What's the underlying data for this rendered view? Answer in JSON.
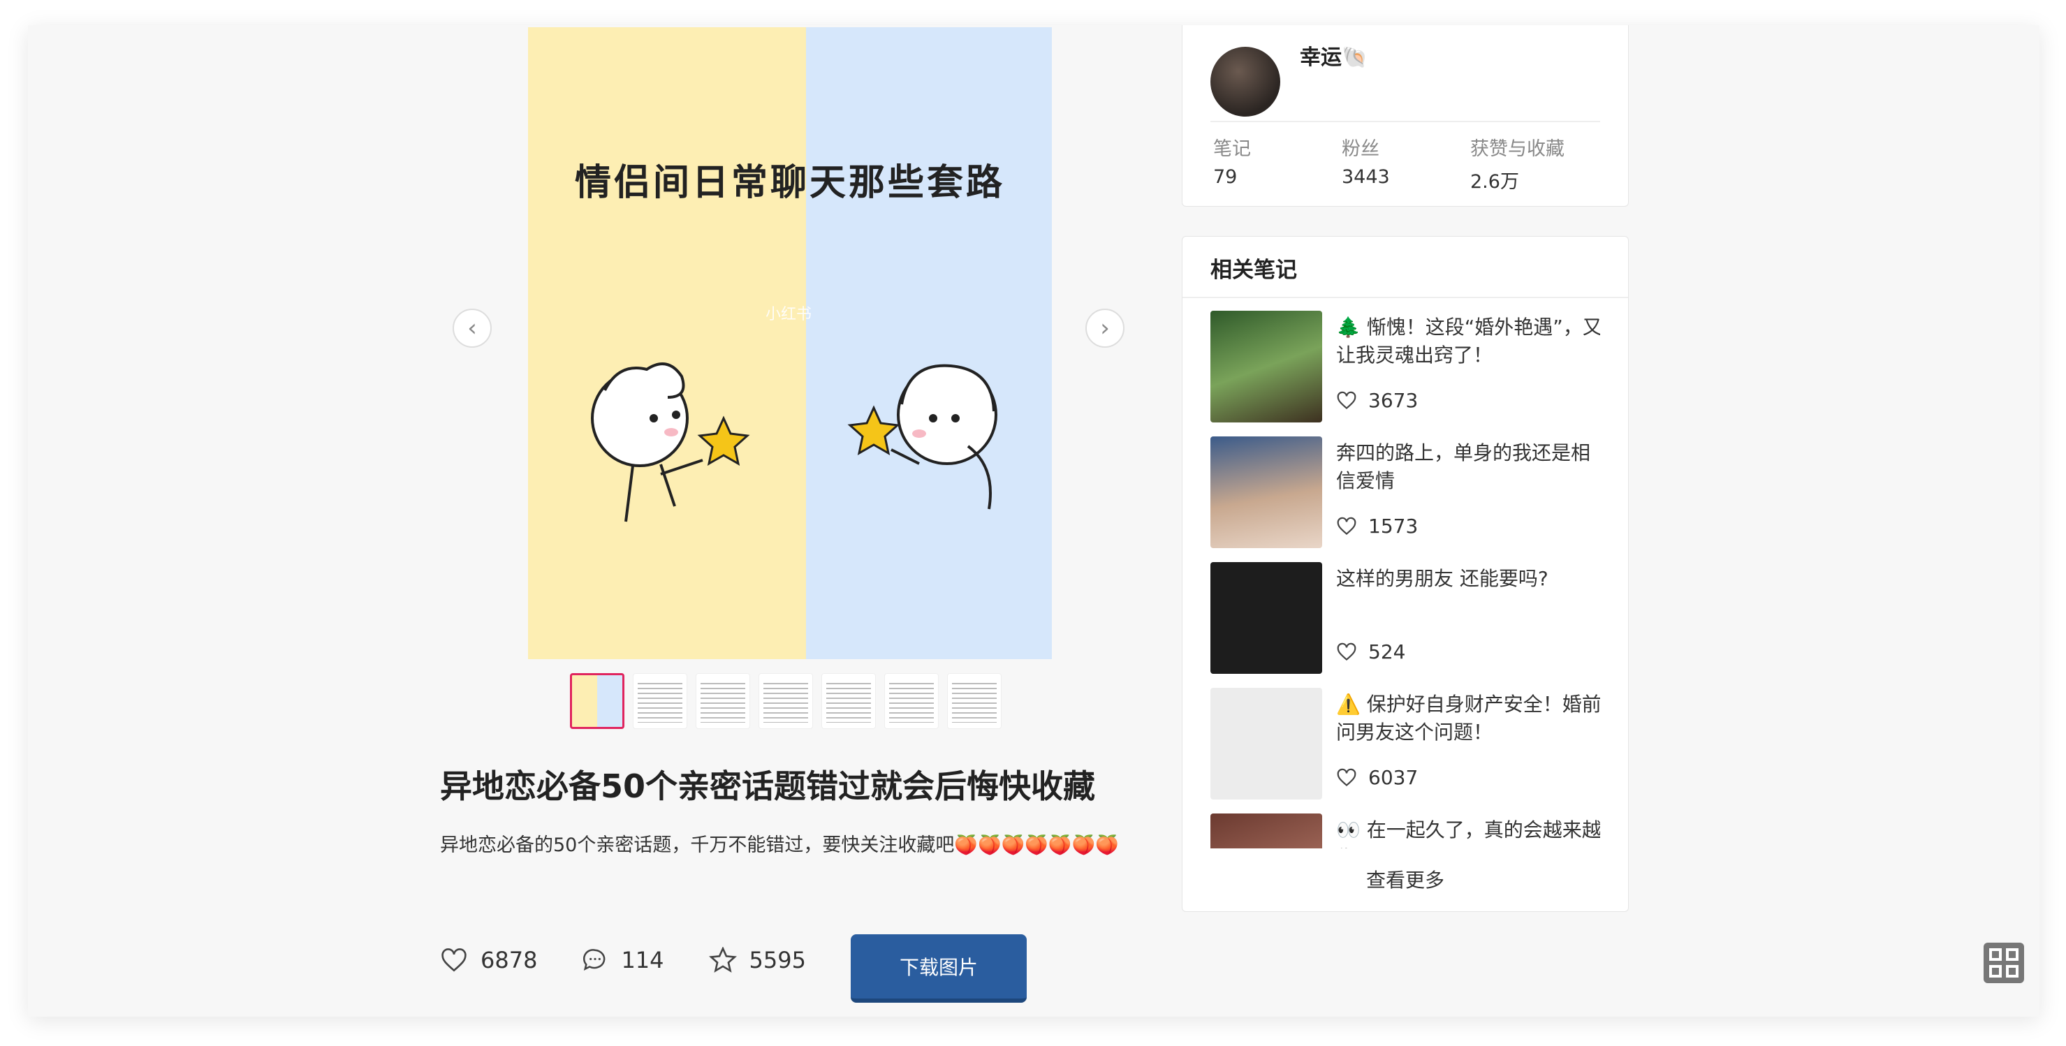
{
  "cover": {
    "headline": "情侣间日常聊天那些套路",
    "watermark": "小红书"
  },
  "thumbnails_count": 7,
  "note": {
    "title": "异地恋必备50个亲密话题错过就会后悔快收藏",
    "description": "异地恋必备的50个亲密话题，千万不能错过，要快关注收藏吧🍑🍑🍑🍑🍑🍑🍑"
  },
  "actions": {
    "likes": "6878",
    "comments": "114",
    "favorites": "5595",
    "download_label": "下载图片"
  },
  "author": {
    "name": "幸运🐚",
    "stats": [
      {
        "label": "笔记",
        "value": "79"
      },
      {
        "label": "粉丝",
        "value": "3443"
      },
      {
        "label": "获赞与收藏",
        "value": "2.6万"
      }
    ]
  },
  "related": {
    "heading": "相关笔记",
    "items": [
      {
        "title": "🌲 惭愧！这段“婚外艳遇”，又让我灵魂出窍了！",
        "likes": "3673"
      },
      {
        "title": "奔四的路上，单身的我还是相信爱情",
        "likes": "1573"
      },
      {
        "title": "这样的男朋友 还能要吗?",
        "likes": "524"
      },
      {
        "title": "⚠️ 保护好自身财产安全！婚前问男友这个问题！",
        "likes": "6037"
      },
      {
        "title": "👀 在一起久了，真的会越来越像吗？😊",
        "likes": ""
      }
    ],
    "more_label": "查看更多"
  },
  "colors": {
    "accent_red": "#e0245e",
    "download_blue": "#2a5d9f"
  }
}
